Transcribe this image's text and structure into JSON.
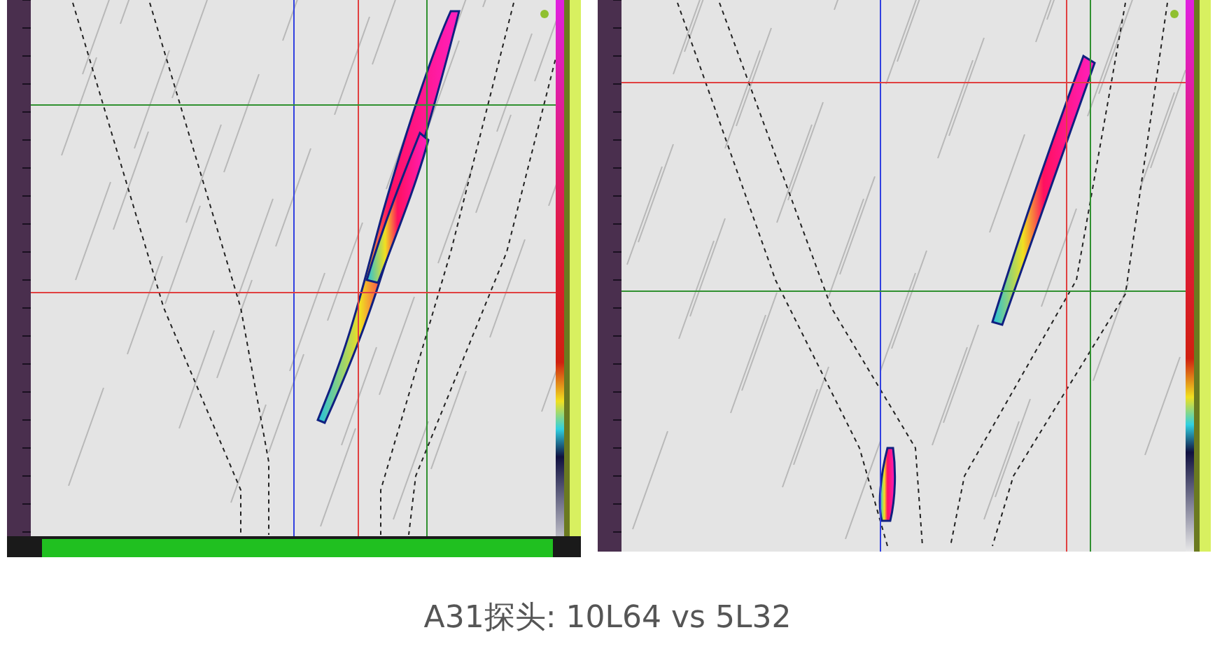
{
  "scans": [
    {
      "kind": "scan",
      "ruler_bottom": true
    },
    {
      "kind": "scan",
      "ruler_bottom": false
    }
  ],
  "caption": "A31探头: 10L64 vs 5L32"
}
